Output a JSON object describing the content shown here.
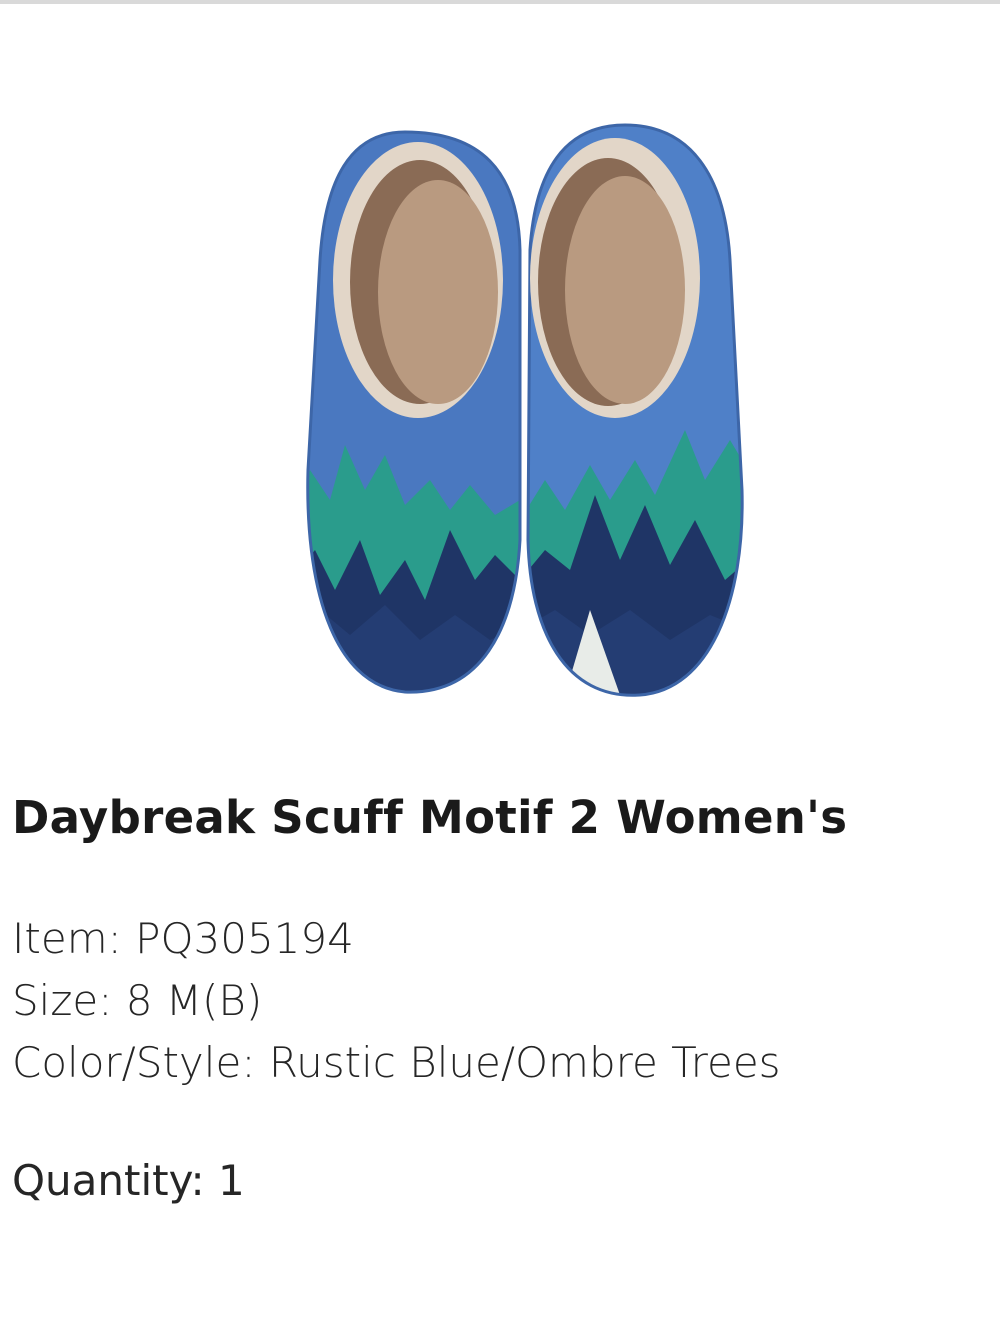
{
  "product": {
    "title": "Daybreak Scuff Motif 2 Women's",
    "image": {
      "icon": "slipper-pair-image",
      "colors": {
        "felt_blue": "#4a78c0",
        "lining_tan": "#c9b39a",
        "tree_teal": "#2a9c8c",
        "tree_navy": "#1f3566",
        "tree_light": "#e8ece8"
      }
    },
    "item": {
      "label": "Item",
      "value": "PQ305194"
    },
    "size": {
      "label": "Size",
      "value": "8 M(B)"
    },
    "color_style": {
      "label": "Color/Style",
      "value": "Rustic Blue/Ombre Trees"
    },
    "quantity": {
      "label": "Quantity",
      "value": "1"
    }
  }
}
